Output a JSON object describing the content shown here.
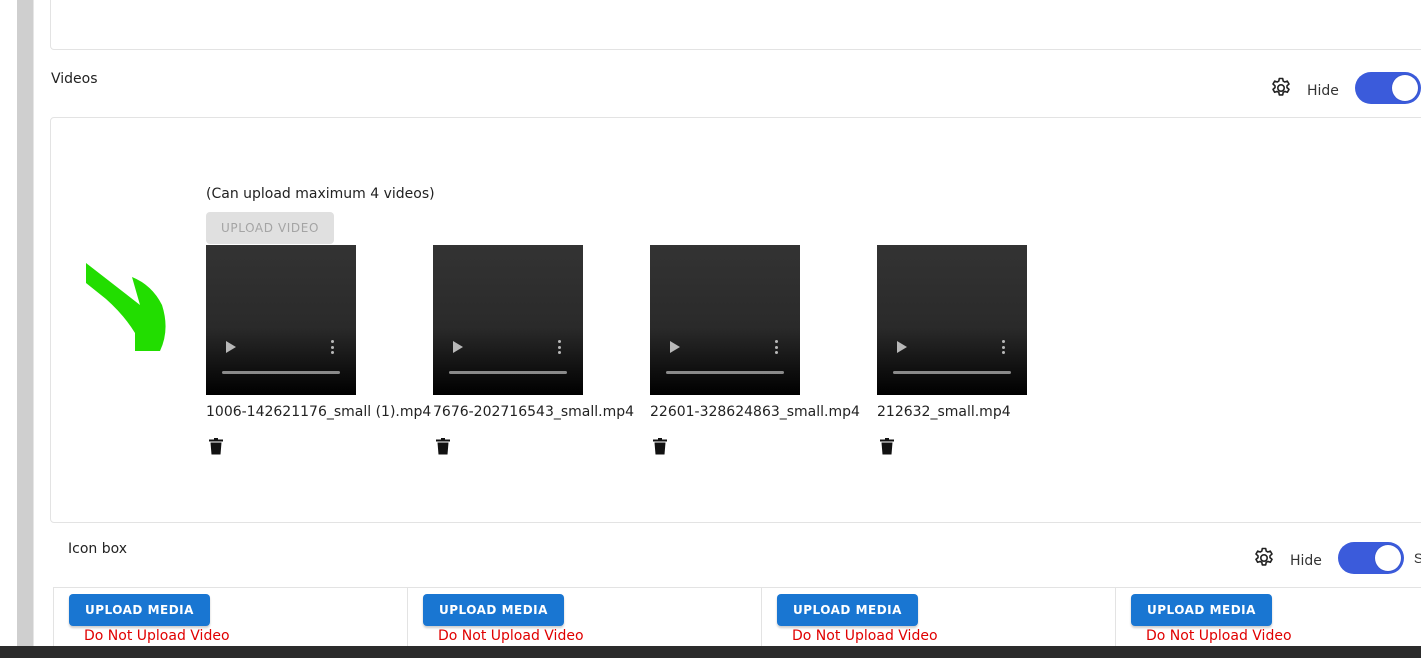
{
  "sections": {
    "videos": {
      "title": "Videos",
      "hide_label": "Hide",
      "toggle_on": true,
      "max_note": "(Can upload maximum 4 videos)",
      "upload_label": "UPLOAD VIDEO",
      "items": [
        {
          "name": "1006-142621176_small (1).mp4"
        },
        {
          "name": "7676-202716543_small.mp4"
        },
        {
          "name": "22601-328624863_small.mp4"
        },
        {
          "name": "212632_small.mp4"
        }
      ]
    },
    "iconbox": {
      "title": "Icon box",
      "hide_label": "Hide",
      "toggle_on": true,
      "trailing_label": "S",
      "cells": [
        {
          "upload_label": "UPLOAD MEDIA",
          "warning": "Do Not Upload Video"
        },
        {
          "upload_label": "UPLOAD MEDIA",
          "warning": "Do Not Upload Video"
        },
        {
          "upload_label": "UPLOAD MEDIA",
          "warning": "Do Not Upload Video"
        },
        {
          "upload_label": "UPLOAD MEDIA",
          "warning": "Do Not Upload Video"
        }
      ]
    }
  },
  "colors": {
    "toggle": "#3b5bdb",
    "primary_button": "#1976d2",
    "warning_text": "#e00000",
    "annotation_arrow": "#22dd00",
    "disabled_button": "#e0e0e0"
  },
  "icons": {
    "settings": "gear-icon",
    "delete": "trash-icon",
    "play": "play-icon",
    "more": "more-vertical-icon",
    "annotation": "arrow-annotation-icon"
  }
}
